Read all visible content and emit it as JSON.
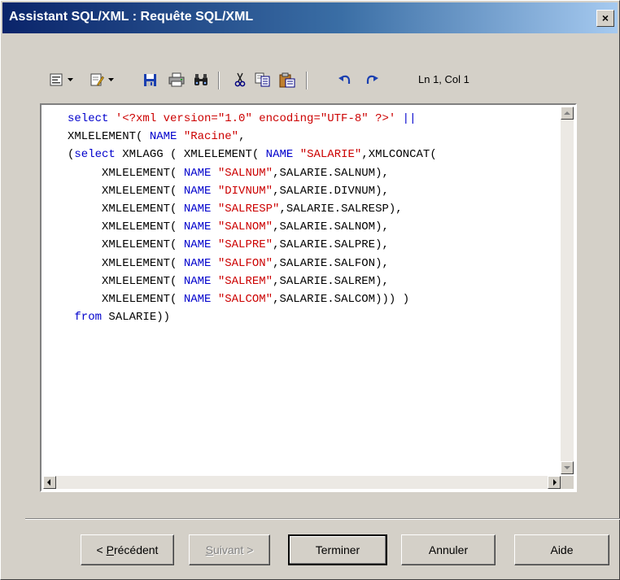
{
  "window": {
    "title": "Assistant SQL/XML : Requête SQL/XML",
    "close_label": "×"
  },
  "toolbar": {
    "icons": [
      "align-icon",
      "dropdown-arrow-icon",
      "edit-icon",
      "dropdown-arrow-icon",
      "save-icon",
      "print-icon",
      "find-icon",
      "cut-icon",
      "copy-icon",
      "paste-icon",
      "undo-icon",
      "redo-icon"
    ],
    "position_readout": "Ln 1, Col 1"
  },
  "editor": {
    "lines": [
      [
        {
          "t": "select ",
          "c": "kw"
        },
        {
          "t": "'<?xml version=\"1.0\" encoding=\"UTF-8\" ?>'",
          "c": "str"
        },
        {
          "t": " ||",
          "c": "kw"
        }
      ],
      [
        {
          "t": "XMLELEMENT( ",
          "c": ""
        },
        {
          "t": "NAME",
          "c": "kw"
        },
        {
          "t": " ",
          "c": ""
        },
        {
          "t": "\"Racine\"",
          "c": "str"
        },
        {
          "t": ",",
          "c": ""
        }
      ],
      [
        {
          "t": "(",
          "c": ""
        },
        {
          "t": "select",
          "c": "kw"
        },
        {
          "t": " XMLAGG ( XMLELEMENT( ",
          "c": ""
        },
        {
          "t": "NAME",
          "c": "kw"
        },
        {
          "t": " ",
          "c": ""
        },
        {
          "t": "\"SALARIE\"",
          "c": "str"
        },
        {
          "t": ",XMLCONCAT(",
          "c": ""
        }
      ],
      [
        {
          "t": "     XMLELEMENT( ",
          "c": ""
        },
        {
          "t": "NAME",
          "c": "kw"
        },
        {
          "t": " ",
          "c": ""
        },
        {
          "t": "\"SALNUM\"",
          "c": "str"
        },
        {
          "t": ",SALARIE.SALNUM),",
          "c": ""
        }
      ],
      [
        {
          "t": "     XMLELEMENT( ",
          "c": ""
        },
        {
          "t": "NAME",
          "c": "kw"
        },
        {
          "t": " ",
          "c": ""
        },
        {
          "t": "\"DIVNUM\"",
          "c": "str"
        },
        {
          "t": ",SALARIE.DIVNUM),",
          "c": ""
        }
      ],
      [
        {
          "t": "     XMLELEMENT( ",
          "c": ""
        },
        {
          "t": "NAME",
          "c": "kw"
        },
        {
          "t": " ",
          "c": ""
        },
        {
          "t": "\"SALRESP\"",
          "c": "str"
        },
        {
          "t": ",SALARIE.SALRESP),",
          "c": ""
        }
      ],
      [
        {
          "t": "     XMLELEMENT( ",
          "c": ""
        },
        {
          "t": "NAME",
          "c": "kw"
        },
        {
          "t": " ",
          "c": ""
        },
        {
          "t": "\"SALNOM\"",
          "c": "str"
        },
        {
          "t": ",SALARIE.SALNOM),",
          "c": ""
        }
      ],
      [
        {
          "t": "     XMLELEMENT( ",
          "c": ""
        },
        {
          "t": "NAME",
          "c": "kw"
        },
        {
          "t": " ",
          "c": ""
        },
        {
          "t": "\"SALPRE\"",
          "c": "str"
        },
        {
          "t": ",SALARIE.SALPRE),",
          "c": ""
        }
      ],
      [
        {
          "t": "     XMLELEMENT( ",
          "c": ""
        },
        {
          "t": "NAME",
          "c": "kw"
        },
        {
          "t": " ",
          "c": ""
        },
        {
          "t": "\"SALFON\"",
          "c": "str"
        },
        {
          "t": ",SALARIE.SALFON),",
          "c": ""
        }
      ],
      [
        {
          "t": "     XMLELEMENT( ",
          "c": ""
        },
        {
          "t": "NAME",
          "c": "kw"
        },
        {
          "t": " ",
          "c": ""
        },
        {
          "t": "\"SALREM\"",
          "c": "str"
        },
        {
          "t": ",SALARIE.SALREM),",
          "c": ""
        }
      ],
      [
        {
          "t": "     XMLELEMENT( ",
          "c": ""
        },
        {
          "t": "NAME",
          "c": "kw"
        },
        {
          "t": " ",
          "c": ""
        },
        {
          "t": "\"SALCOM\"",
          "c": "str"
        },
        {
          "t": ",SALARIE.SALCOM))) )",
          "c": ""
        }
      ],
      [
        {
          "t": " ",
          "c": ""
        },
        {
          "t": "from",
          "c": "kw"
        },
        {
          "t": " SALARIE))",
          "c": ""
        }
      ]
    ]
  },
  "buttons": {
    "previous_prefix": "< ",
    "previous_mnemonic": "P",
    "previous_rest": "récédent",
    "next_mnemonic": "S",
    "next_rest": "uivant >",
    "finish": "Terminer",
    "cancel": "Annuler",
    "help": "Aide"
  },
  "colors": {
    "keyword": "#0000cc",
    "string": "#cc0000",
    "titlebar_start": "#0a246a",
    "titlebar_end": "#a6caf0",
    "face": "#d4d0c8"
  }
}
